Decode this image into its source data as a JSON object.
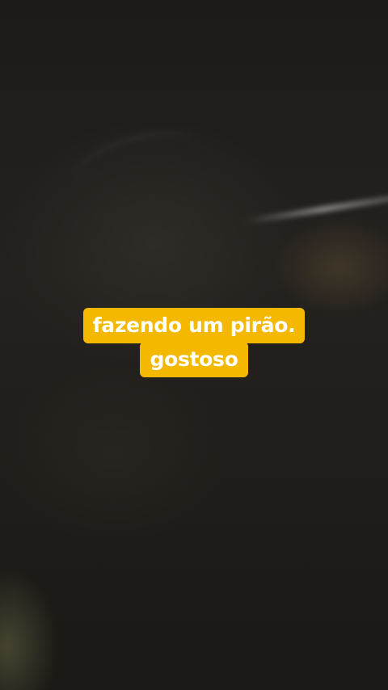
{
  "caption": {
    "line1": "fazendo um pirão.",
    "line2": "gostoso",
    "background_color": "#f5b800",
    "text_color": "#ffffff"
  }
}
